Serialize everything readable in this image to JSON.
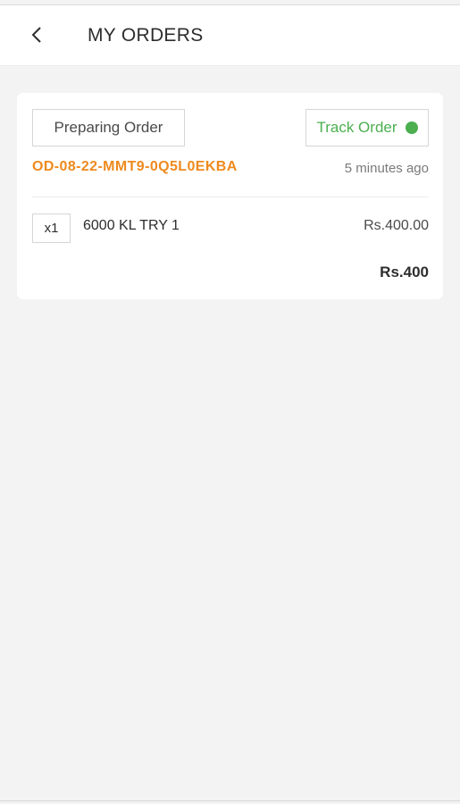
{
  "header": {
    "title": "MY ORDERS",
    "back_icon": "chevron-left-icon"
  },
  "orders": [
    {
      "status": "Preparing Order",
      "track_label": "Track Order",
      "track_indicator_color": "#4caf50",
      "order_id": "OD-08-22-MMT9-0Q5L0EKBA",
      "time_ago": "5 minutes ago",
      "items": [
        {
          "quantity": "x1",
          "name": "6000 KL TRY 1",
          "price": "Rs.400.00"
        }
      ],
      "total": "Rs.400"
    }
  ],
  "colors": {
    "background": "#f3f3f3",
    "card": "#ffffff",
    "accent_orange": "#ee8a1f",
    "accent_green": "#4caf50"
  }
}
